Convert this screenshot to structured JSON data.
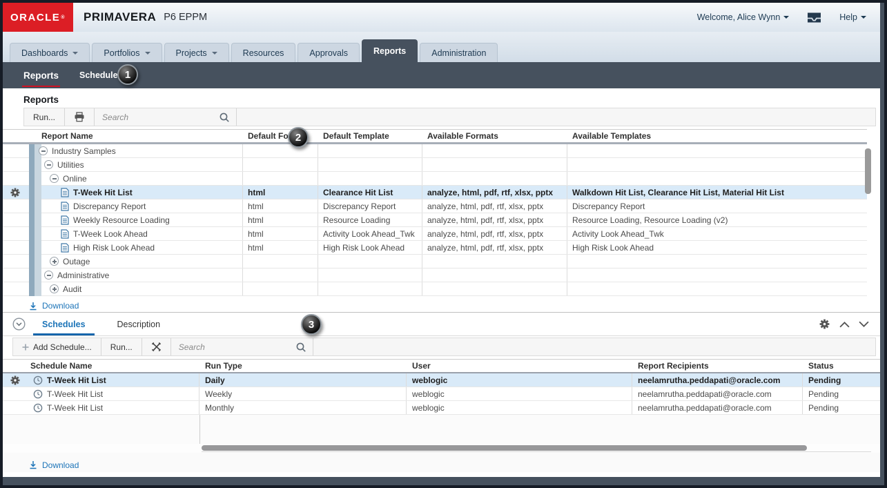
{
  "colors": {
    "oracle_red": "#DC1E25",
    "dark_slate": "#46515E",
    "active_subnav_underline": "#CF1223",
    "selected_row": "#D9EAF8",
    "link_blue": "#1C74B8",
    "schedules_tab_underline": "#1565AB"
  },
  "header": {
    "logo": "ORACLE",
    "logo_mark": "®",
    "brand": "PRIMAVERA",
    "product": "P6 EPPM",
    "welcome": "Welcome, Alice Wynn",
    "help": "Help"
  },
  "nav_tabs": [
    {
      "label": "Dashboards",
      "dropdown": true,
      "active": false
    },
    {
      "label": "Portfolios",
      "dropdown": true,
      "active": false
    },
    {
      "label": "Projects",
      "dropdown": true,
      "active": false
    },
    {
      "label": "Resources",
      "dropdown": false,
      "active": false
    },
    {
      "label": "Approvals",
      "dropdown": false,
      "active": false
    },
    {
      "label": "Reports",
      "dropdown": false,
      "active": true
    },
    {
      "label": "Administration",
      "dropdown": false,
      "active": false
    }
  ],
  "subnav": {
    "items": [
      {
        "label": "Reports",
        "active": true
      },
      {
        "label": "Schedules",
        "active": false
      }
    ],
    "annotation": "1"
  },
  "reports_panel": {
    "title": "Reports",
    "annotation": "2",
    "toolbar": {
      "run_label": "Run...",
      "search_placeholder": "Search"
    },
    "columns": [
      "Report Name",
      "Default Format",
      "Default Template",
      "Available Formats",
      "Available Templates"
    ],
    "rows": [
      {
        "group": true,
        "minus": true,
        "level": 0,
        "name": "Industry Samples",
        "format": "",
        "template": "",
        "formats": "",
        "templates": "",
        "selected": false
      },
      {
        "group": true,
        "minus": true,
        "level": 1,
        "name": "Utilities",
        "format": "",
        "template": "",
        "formats": "",
        "templates": "",
        "selected": false
      },
      {
        "group": true,
        "minus": true,
        "level": 2,
        "name": "Online",
        "format": "",
        "template": "",
        "formats": "",
        "templates": "",
        "selected": false
      },
      {
        "doc": true,
        "level": 3,
        "name": "T-Week Hit List",
        "format": "html",
        "template": "Clearance Hit List",
        "formats": "analyze, html, pdf, rtf, xlsx, pptx",
        "templates": "Walkdown Hit List, Clearance Hit List, Material Hit List",
        "selected": true
      },
      {
        "doc": true,
        "level": 3,
        "name": "Discrepancy Report",
        "format": "html",
        "template": "Discrepancy Report",
        "formats": "analyze, html, pdf, rtf, xlsx, pptx",
        "templates": "Discrepancy Report",
        "selected": false
      },
      {
        "doc": true,
        "level": 3,
        "name": "Weekly Resource Loading",
        "format": "html",
        "template": "Resource Loading",
        "formats": "analyze, html, pdf, rtf, xlsx, pptx",
        "templates": "Resource Loading, Resource Loading (v2)",
        "selected": false
      },
      {
        "doc": true,
        "level": 3,
        "name": "T-Week Look Ahead",
        "format": "html",
        "template": "Activity Look Ahead_Twk",
        "formats": "analyze, html, pdf, rtf, xlsx, pptx",
        "templates": "Activity Look Ahead_Twk",
        "selected": false
      },
      {
        "doc": true,
        "level": 3,
        "name": "High Risk Look Ahead",
        "format": "html",
        "template": "High Risk Look Ahead",
        "formats": "analyze, html, pdf, rtf, xlsx, pptx",
        "templates": "High Risk Look Ahead",
        "selected": false
      },
      {
        "group": true,
        "plus": true,
        "level": 2,
        "name": "Outage",
        "format": "",
        "template": "",
        "formats": "",
        "templates": "",
        "selected": false
      },
      {
        "group": true,
        "minus": true,
        "level": 1,
        "name": "Administrative",
        "format": "",
        "template": "",
        "formats": "",
        "templates": "",
        "selected": false
      },
      {
        "group": true,
        "plus": true,
        "level": 2,
        "name": "Audit",
        "format": "",
        "template": "",
        "formats": "",
        "templates": "",
        "selected": false
      }
    ],
    "download_label": "Download"
  },
  "schedules_panel": {
    "annotation": "3",
    "tabs": [
      {
        "label": "Schedules",
        "active": true
      },
      {
        "label": "Description",
        "active": false
      }
    ],
    "toolbar": {
      "add_label": "Add Schedule...",
      "run_label": "Run...",
      "search_placeholder": "Search"
    },
    "columns": [
      "Schedule Name",
      "Run Type",
      "User",
      "Report Recipients",
      "Status"
    ],
    "rows": [
      {
        "name": "T-Week Hit List",
        "run_type": "Daily",
        "user": "weblogic",
        "recipients": "neelamrutha.peddapati@oracle.com",
        "status": "Pending",
        "selected": true
      },
      {
        "name": "T-Week Hit List",
        "run_type": "Weekly",
        "user": "weblogic",
        "recipients": "neelamrutha.peddapati@oracle.com",
        "status": "Pending",
        "selected": false
      },
      {
        "name": "T-Week Hit List",
        "run_type": "Monthly",
        "user": "weblogic",
        "recipients": "neelamrutha.peddapati@oracle.com",
        "status": "Pending",
        "selected": false
      }
    ],
    "download_label": "Download"
  }
}
